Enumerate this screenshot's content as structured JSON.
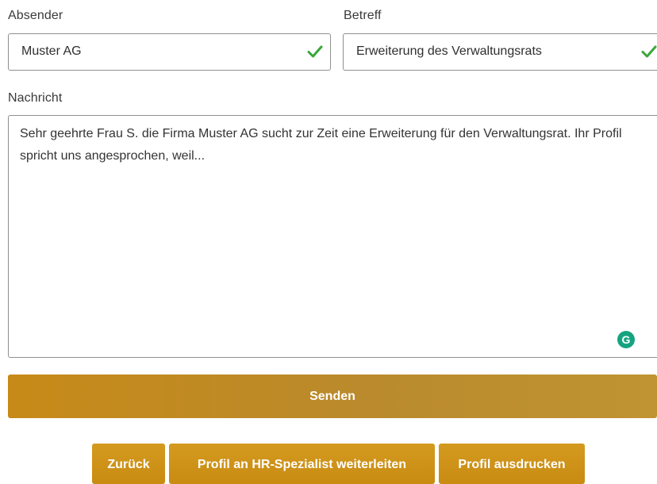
{
  "form": {
    "sender": {
      "label": "Absender",
      "value": "Muster AG",
      "valid": true,
      "status_icon": "checkmark-icon"
    },
    "subject": {
      "label": "Betreff",
      "value": "Erweiterung des Verwaltungsrats",
      "valid": true,
      "status_icon": "checkmark-icon"
    },
    "message": {
      "label": "Nachricht",
      "value": "Sehr geehrte Frau S.  die Firma Muster AG sucht zur Zeit eine Erweiterung für den Verwaltungsrat. Ihr Profil spricht uns angesprochen, weil...",
      "assistant_icon": "grammarly-icon",
      "assistant_glyph": "G"
    },
    "send_label": "Senden"
  },
  "actions": {
    "back_label": "Zurück",
    "forward_label": "Profil an HR-Spezialist weiterleiten",
    "print_label": "Profil ausdrucken"
  },
  "colors": {
    "accent": "#c98b12",
    "check_green": "#3aa63a",
    "grammarly_green": "#15a37f",
    "field_border": "#8f8f8f"
  }
}
